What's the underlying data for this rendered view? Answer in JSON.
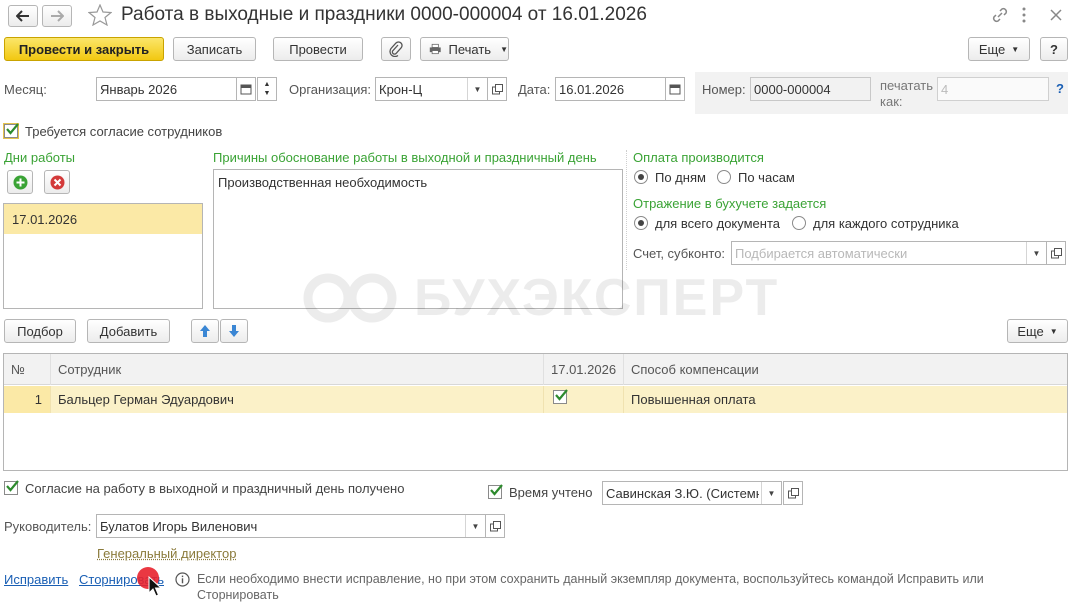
{
  "window": {
    "title": "Работа в выходные и праздники 0000-000004 от 16.01.2026"
  },
  "toolbar": {
    "post_close": "Провести и закрыть",
    "save": "Записать",
    "post": "Провести",
    "print": "Печать",
    "more": "Еще",
    "help": "?"
  },
  "header": {
    "month_label": "Месяц:",
    "month_value": "Январь 2026",
    "org_label": "Организация:",
    "org_value": "Крон-Ц",
    "date_label": "Дата:",
    "date_value": "16.01.2026",
    "number_label": "Номер:",
    "number_value": "0000-000004",
    "print_as_label_1": "печатать",
    "print_as_label_2": "как:",
    "print_as_value": "4",
    "help": "?"
  },
  "consent_required": {
    "label": "Требуется согласие сотрудников",
    "checked": true
  },
  "work_days": {
    "title": "Дни работы",
    "items": [
      "17.01.2026"
    ]
  },
  "reasons": {
    "title": "Причины обоснование работы в выходной и праздничный день",
    "text": "Производственная необходимость"
  },
  "payment": {
    "title": "Оплата производится",
    "option_days": "По дням",
    "option_hours": "По часам",
    "selected": "По дням"
  },
  "accounting": {
    "title": "Отражение в бухучете задается",
    "option_doc": "для всего документа",
    "option_each": "для каждого сотрудника",
    "selected": "для всего документа",
    "account_label": "Счет, субконто:",
    "account_placeholder": "Подбирается автоматически"
  },
  "table_toolbar": {
    "select": "Подбор",
    "add": "Добавить",
    "more": "Еще"
  },
  "table": {
    "columns": [
      "№",
      "Сотрудник",
      "17.01.2026",
      "Способ компенсации"
    ],
    "rows": [
      {
        "num": "1",
        "employee": "Бальцер Герман Эдуардович",
        "checked": true,
        "compensation": "Повышенная оплата"
      }
    ]
  },
  "footer": {
    "consent_received": "Согласие на работу в выходной и праздничный день получено",
    "time_accounted": "Время учтено",
    "time_person": "Савинская З.Ю. (Системный",
    "manager_label": "Руководитель:",
    "manager_value": "Булатов Игорь Виленович",
    "manager_position": "Генеральный директор",
    "fix_link": "Исправить",
    "storno_link": "Сторнировать",
    "info_text_1": "Если необходимо внести исправление, но при этом сохранить данный экземпляр документа, воспользуйтесь командой Исправить или",
    "info_text_2": "Сторнировать"
  },
  "watermark": "БУХЭКСПЕРТ"
}
